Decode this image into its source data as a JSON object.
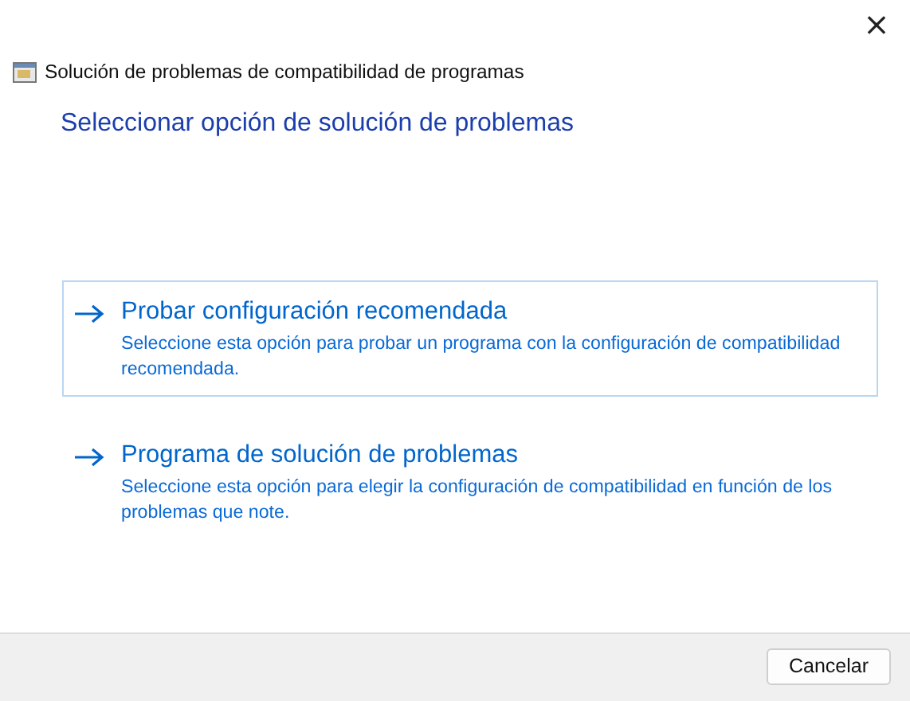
{
  "window": {
    "title": "Solución de problemas de compatibilidad de programas",
    "close": "×"
  },
  "heading": "Seleccionar opción de solución de problemas",
  "options": [
    {
      "title": "Probar configuración recomendada",
      "description": "Seleccione esta opción para probar un programa con la configuración de compatibilidad recomendada.",
      "selected": true
    },
    {
      "title": "Programa de solución de problemas",
      "description": "Seleccione esta opción para elegir la configuración de compatibilidad en función de los problemas que note.",
      "selected": false
    }
  ],
  "buttons": [
    "Cancelar"
  ]
}
